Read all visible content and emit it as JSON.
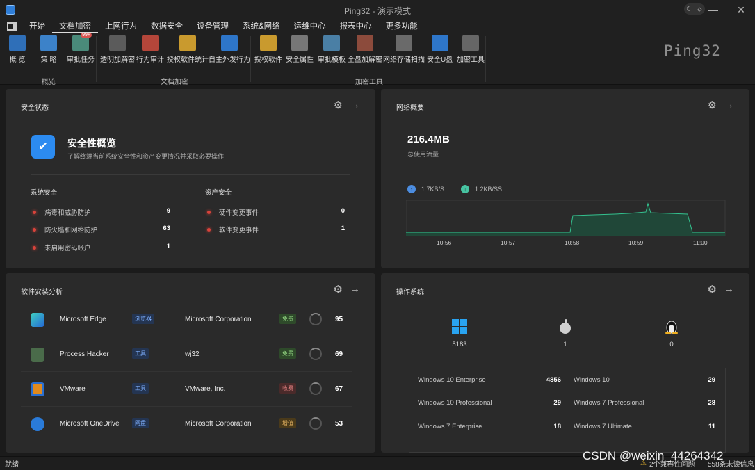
{
  "window": {
    "title": "Ping32 - 演示模式"
  },
  "menu": [
    "开始",
    "文档加密",
    "上网行为",
    "数据安全",
    "设备管理",
    "系统&网络",
    "运维中心",
    "报表中心",
    "更多功能"
  ],
  "ribbon": {
    "buttons": [
      "概 览",
      "策 略",
      "审批任务",
      "透明加解密",
      "行为审计",
      "授权软件统计",
      "自主外发行为",
      "授权软件",
      "安全属性",
      "审批模板",
      "全盘加解密",
      "网络存储扫描",
      "安全U盘",
      "加密工具"
    ],
    "groups": [
      "概览",
      "文档加密",
      "加密工具"
    ],
    "brand": "Ping32"
  },
  "security": {
    "title": "安全状态",
    "heading": "安全性概览",
    "desc": "了解终端当前系统安全性和资产变更情况并采取必要操作",
    "system_title": "系统安全",
    "system_items": [
      {
        "label": "病毒和威胁防护",
        "value": "9"
      },
      {
        "label": "防火墙和网络防护",
        "value": "63"
      },
      {
        "label": "未启用密码帐户",
        "value": "1"
      }
    ],
    "asset_title": "资产安全",
    "asset_items": [
      {
        "label": "硬件变更事件",
        "value": "0"
      },
      {
        "label": "软件变更事件",
        "value": "1"
      }
    ]
  },
  "network": {
    "title": "网络概要",
    "total": "216.4MB",
    "total_label": "总使用流量",
    "up": "1.7KB/S",
    "down": "1.2KB/SS",
    "times": [
      "10:56",
      "10:57",
      "10:58",
      "10:59",
      "11:00"
    ]
  },
  "software": {
    "title": "软件安装分析",
    "rows": [
      {
        "name": "Microsoft Edge",
        "category": "浏览器",
        "vendor": "Microsoft Corporation",
        "license": "免费",
        "count": "95"
      },
      {
        "name": "Process Hacker",
        "category": "工具",
        "vendor": "wj32",
        "license": "免费",
        "count": "69"
      },
      {
        "name": "VMware",
        "category": "工具",
        "vendor": "VMware, Inc.",
        "license": "收费",
        "count": "67"
      },
      {
        "name": "Microsoft OneDrive",
        "category": "网盘",
        "vendor": "Microsoft Corporation",
        "license": "增值",
        "count": "53"
      }
    ]
  },
  "os": {
    "title": "操作系统",
    "windows_count": "5183",
    "mac_count": "1",
    "linux_count": "0",
    "table": [
      {
        "name": "Windows 10 Enterprise",
        "value": "4856"
      },
      {
        "name": "Windows 10",
        "value": "29"
      },
      {
        "name": "Windows 10 Professional",
        "value": "29"
      },
      {
        "name": "Windows 7 Professional",
        "value": "28"
      },
      {
        "name": "Windows 7 Enterprise",
        "value": "18"
      },
      {
        "name": "Windows 7 Ultimate",
        "value": "11"
      }
    ]
  },
  "status": {
    "left": "就绪",
    "compat": "2个兼容性问题",
    "unread": "558条未读信息"
  },
  "watermark": "CSDN @weixin_44264342"
}
